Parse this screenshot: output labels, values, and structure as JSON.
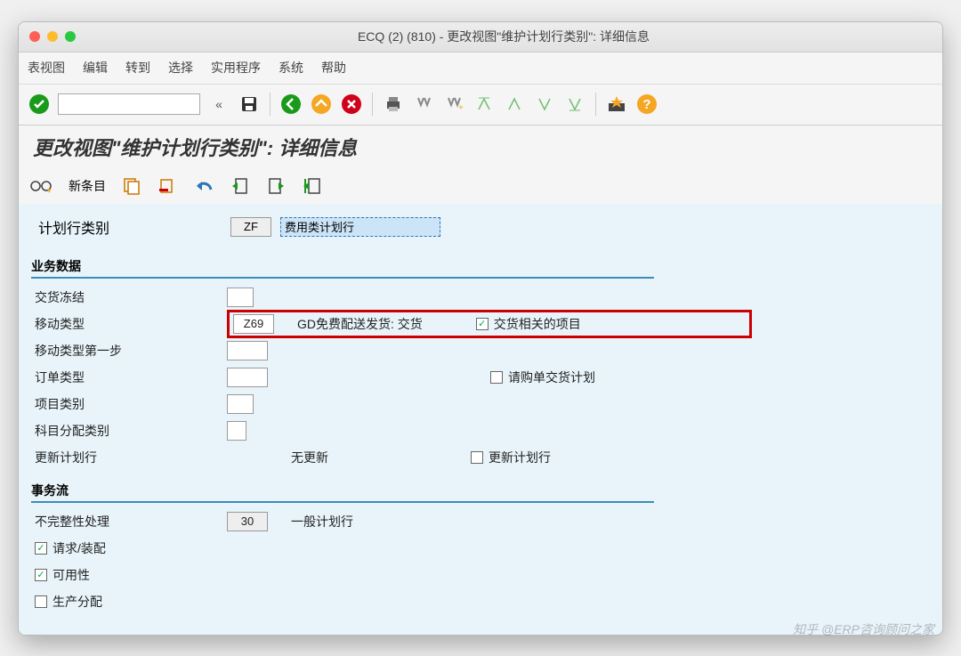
{
  "window": {
    "title": "ECQ (2) (810) - 更改视图\"维护计划行类别\":  详细信息"
  },
  "menu": {
    "items": [
      "表视图",
      "编辑",
      "转到",
      "选择",
      "实用程序",
      "系统",
      "帮助"
    ]
  },
  "heading": "更改视图\"维护计划行类别\":  详细信息",
  "subtoolbar": {
    "new_entry": "新条目"
  },
  "header_row": {
    "label": "计划行类别",
    "code": "ZF",
    "value": "费用类计划行"
  },
  "business": {
    "title": "业务数据",
    "rows": {
      "delivery_block": {
        "label": "交货冻结"
      },
      "movement_type": {
        "label": "移动类型",
        "code": "Z69",
        "desc": "GD免费配送发货: 交货",
        "checkbox_label": "交货相关的项目",
        "checked": true
      },
      "movement_type_step1": {
        "label": "移动类型第一步"
      },
      "order_type": {
        "label": "订单类型",
        "checkbox_label": "请购单交货计划",
        "checked": false
      },
      "item_category": {
        "label": "项目类别"
      },
      "account_assign": {
        "label": "科目分配类别"
      },
      "update_schedule": {
        "label": "更新计划行",
        "desc": "无更新",
        "checkbox_label": "更新计划行",
        "checked": false
      }
    }
  },
  "transaction": {
    "title": "事务流",
    "incompleteness": {
      "label": "不完整性处理",
      "code": "30",
      "desc": "一般计划行"
    },
    "req_assembly": {
      "label": "请求/装配",
      "checked": true
    },
    "availability": {
      "label": "可用性",
      "checked": true
    },
    "prod_alloc": {
      "label": "生产分配",
      "checked": false
    }
  },
  "watermark": "知乎 @ERP咨询顾问之家"
}
